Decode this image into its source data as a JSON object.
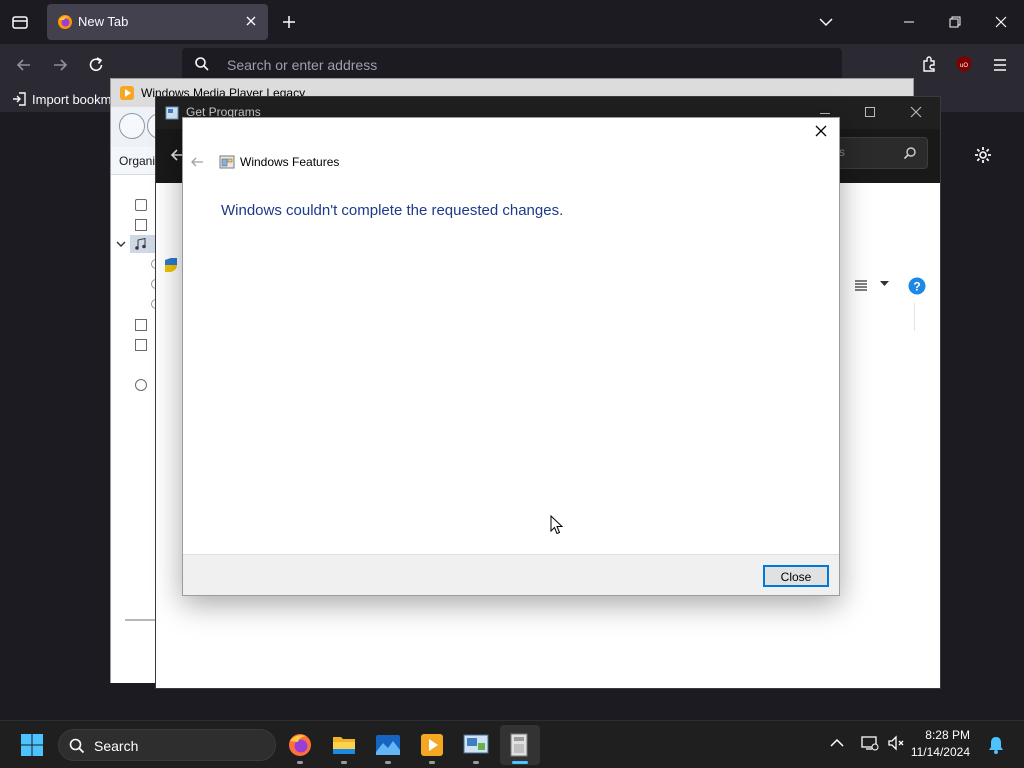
{
  "browser": {
    "tab_title": "New Tab",
    "address_placeholder": "Search or enter address",
    "bookmark_import_label": "Import bookm"
  },
  "wmp": {
    "title": "Windows Media Player Legacy",
    "organize_label": "Organi"
  },
  "get_programs": {
    "title": "Get Programs",
    "search_placeholder": "s"
  },
  "dialog": {
    "title": "Windows Features",
    "message": "Windows couldn't complete the requested changes.",
    "close_button": "Close"
  },
  "taskbar": {
    "search_label": "Search",
    "time": "8:28 PM",
    "date": "11/14/2024"
  },
  "colors": {
    "message_text": "#1e3a8a",
    "accent": "#0078d7",
    "help_icon": "#1e88e5",
    "ublock": "#800000"
  },
  "icons": [
    "tab-overview-icon",
    "firefox-icon",
    "close-tab-icon",
    "new-tab-icon",
    "list-tabs-icon",
    "minimize-icon",
    "restore-icon",
    "close-icon",
    "back-icon",
    "forward-icon",
    "reload-icon",
    "search-icon",
    "extensions-icon",
    "ublock-icon",
    "menu-icon",
    "import-icon",
    "wmp-icon",
    "back-arrow-icon",
    "windows-features-icon",
    "shield-icon",
    "view-list-icon",
    "help-icon",
    "settings-icon",
    "start-icon",
    "folder-icon",
    "notification-bell-icon"
  ]
}
